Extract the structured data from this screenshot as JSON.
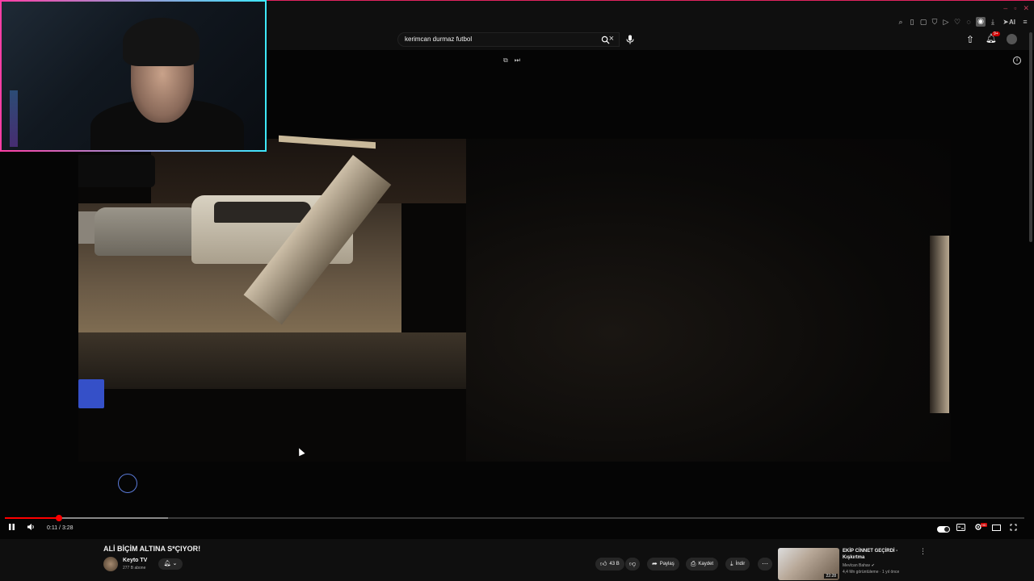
{
  "browser": {
    "window_controls": [
      "–",
      "▫",
      "✕"
    ],
    "toolbar_ai_label": "AI"
  },
  "header": {
    "search_value": "kerimcan durmaz futbol",
    "notification_badge": "9+"
  },
  "player": {
    "current_time": "0:11",
    "duration": "3:28",
    "time_display": "0:11 / 3:28",
    "progress_fraction": 0.053,
    "buffer_fraction": 0.16,
    "autoplay": true,
    "quality_badge": "HD"
  },
  "video": {
    "title": "ALİ BİÇİM ALTINA S*ÇIYOR!",
    "channel_name": "Keyto TV",
    "subscribers": "277 B abone",
    "likes": "43 B",
    "share_label": "Paylaş",
    "save_label": "Kaydet",
    "download_label": "İndir"
  },
  "recommendation": {
    "title": "EKİP CİNNET GEÇİRDİ - Kışkırtma",
    "channel": "Mevlcan Bahav",
    "meta": "4,4 Mn görüntüleme · 1 yıl önce",
    "duration": "22:28"
  },
  "colors": {
    "progress": "#ff0000",
    "webcam_border_start": "#ff3ea5",
    "webcam_border_end": "#3ee8ff",
    "background": "#0f0f0f"
  }
}
